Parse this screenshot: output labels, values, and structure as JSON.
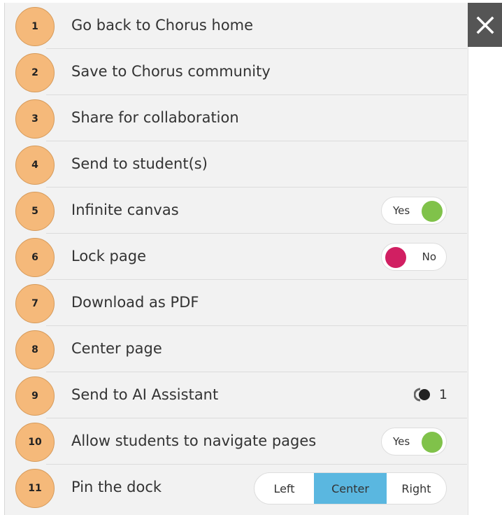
{
  "close_icon": "close-icon",
  "colors": {
    "badge": "#f5b97a",
    "toggle_on": "#80c24a",
    "toggle_off": "#d11f62",
    "segment_active": "#5ab7e0",
    "close_bg": "#555555"
  },
  "menu": {
    "items": [
      {
        "number": "1",
        "label": "Go back to Chorus home"
      },
      {
        "number": "2",
        "label": "Save to Chorus community"
      },
      {
        "number": "3",
        "label": "Share for collaboration"
      },
      {
        "number": "4",
        "label": "Send to student(s)"
      },
      {
        "number": "5",
        "label": "Infinite canvas",
        "toggle": "Yes"
      },
      {
        "number": "6",
        "label": "Lock page",
        "toggle": "No"
      },
      {
        "number": "7",
        "label": "Download as PDF"
      },
      {
        "number": "8",
        "label": "Center page"
      },
      {
        "number": "9",
        "label": "Send to AI Assistant",
        "count": "1"
      },
      {
        "number": "10",
        "label": "Allow students to navigate pages",
        "toggle": "Yes"
      },
      {
        "number": "11",
        "label": "Pin the dock",
        "options": [
          "Left",
          "Center",
          "Right"
        ],
        "selected": "Center"
      }
    ]
  }
}
